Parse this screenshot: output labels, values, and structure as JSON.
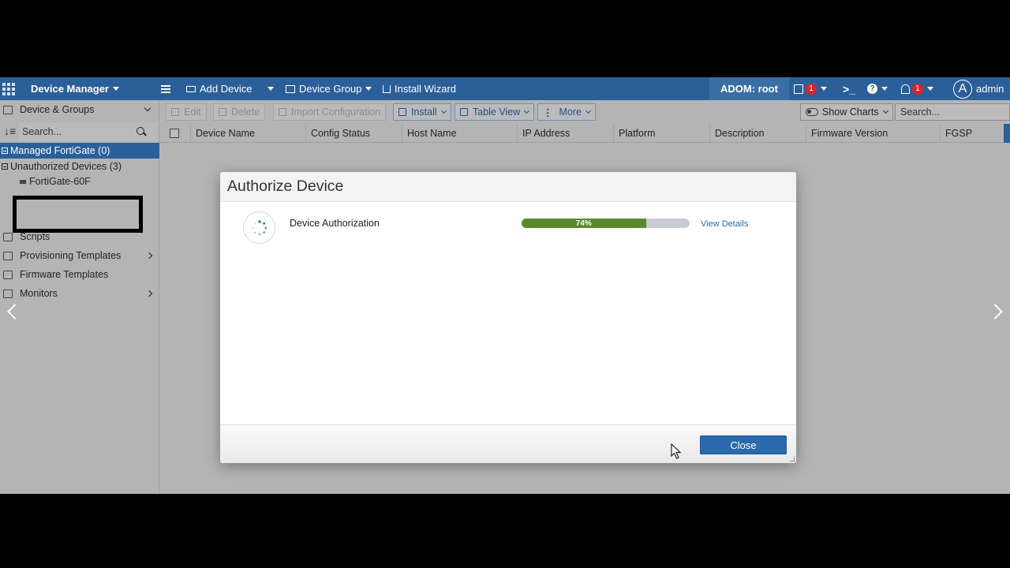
{
  "topbar": {
    "app_title": "Device Manager",
    "add_device": "Add Device",
    "device_group": "Device Group",
    "install_wizard": "Install Wizard",
    "adom": "ADOM: root",
    "task_badge": "1",
    "alert_badge": "1",
    "avatar_letter": "A",
    "user": "admin"
  },
  "sidebar": {
    "section_title": "Device & Groups",
    "search_placeholder": "Search...",
    "managed": "Managed FortiGate (0)",
    "unauthorized": "Unauthorized Devices (3)",
    "device_1": "FortiGate-60F",
    "items": [
      {
        "label": "Scripts"
      },
      {
        "label": "Provisioning Templates"
      },
      {
        "label": "Firmware Templates"
      },
      {
        "label": "Monitors"
      }
    ]
  },
  "toolbar": {
    "edit": "Edit",
    "delete": "Delete",
    "import_config": "Import Configuration",
    "install": "Install",
    "table_view": "Table View",
    "more": "More",
    "show_charts": "Show Charts",
    "search_placeholder": "Search..."
  },
  "table": {
    "columns": [
      "Device Name",
      "Config Status",
      "Host Name",
      "IP Address",
      "Platform",
      "Description",
      "Firmware Version",
      "FGSP"
    ]
  },
  "modal": {
    "title": "Authorize Device",
    "task_name": "Device Authorization",
    "progress_percent": 74,
    "progress_label": "74%",
    "view_details": "View Details",
    "close_label": "Close"
  },
  "colors": {
    "brand_blue": "#2b5f99",
    "progress_green": "#5b8a2e",
    "close_button": "#2a6aad"
  }
}
